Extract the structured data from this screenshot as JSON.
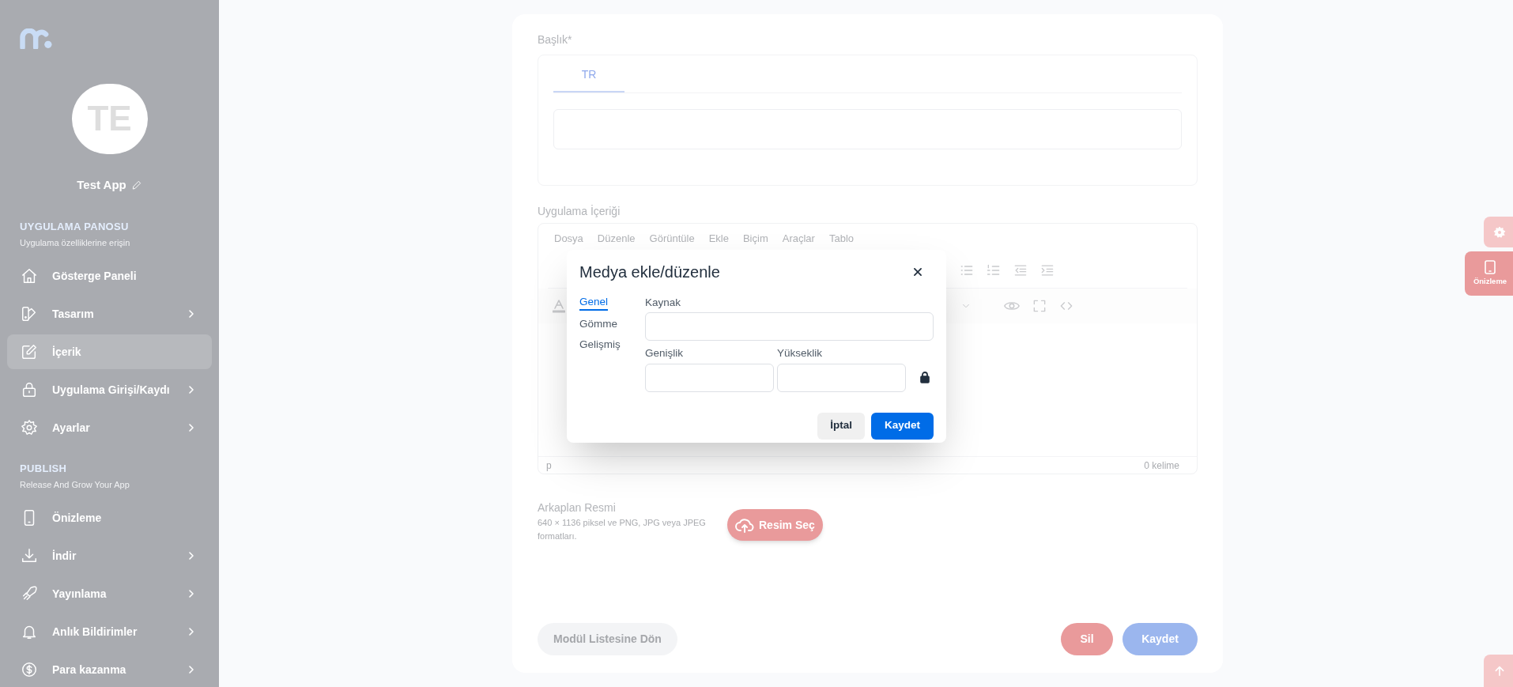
{
  "sidebar": {
    "avatar": {
      "initials": "TE"
    },
    "app_name": "Test App",
    "sections": [
      {
        "title": "UYGULAMA PANOSU",
        "subtitle": "Uygulama özelliklerine erişin",
        "items": [
          {
            "label": "Gösterge Paneli",
            "selected": false,
            "has_submenu": false
          },
          {
            "label": "Tasarım",
            "selected": false,
            "has_submenu": true
          },
          {
            "label": "İçerik",
            "selected": true,
            "has_submenu": false
          },
          {
            "label": "Uygulama Girişi/Kaydı",
            "selected": false,
            "has_submenu": true
          },
          {
            "label": "Ayarlar",
            "selected": false,
            "has_submenu": true
          }
        ]
      },
      {
        "title": "PUBLISH",
        "subtitle": "Release And Grow Your App",
        "items": [
          {
            "label": "Önizleme",
            "selected": false,
            "has_submenu": false
          },
          {
            "label": "İndir",
            "selected": false,
            "has_submenu": true
          },
          {
            "label": "Yayınlama",
            "selected": false,
            "has_submenu": true
          },
          {
            "label": "Anlık Bildirimler",
            "selected": false,
            "has_submenu": true
          },
          {
            "label": "Para kazanma",
            "selected": false,
            "has_submenu": true
          }
        ]
      }
    ]
  },
  "form": {
    "title_label": "Başlık*",
    "language_tabs": [
      {
        "label": "TR",
        "selected": true
      }
    ],
    "content_label": "Uygulama İçeriği",
    "editor": {
      "menu": [
        "Dosya",
        "Düzenle",
        "Görüntüle",
        "Ekle",
        "Biçim",
        "Araçlar",
        "Tablo"
      ],
      "status_path": "p",
      "word_count": "0 kelime"
    },
    "background": {
      "label": "Arkaplan Resmi",
      "hint": "640 × 1136 piksel ve PNG, JPG veya JPEG formatları.",
      "button": "Resim Seç"
    },
    "back_button": "Modül Listesine Dön",
    "delete_button": "Sil",
    "save_button": "Kaydet"
  },
  "floating": {
    "preview_label": "Önizleme"
  },
  "modal": {
    "title": "Medya ekle/düzenle",
    "tabs": [
      {
        "label": "Genel",
        "selected": true
      },
      {
        "label": "Gömme",
        "selected": false
      },
      {
        "label": "Gelişmiş",
        "selected": false
      }
    ],
    "source_label": "Kaynak",
    "width_label": "Genişlik",
    "height_label": "Yükseklik",
    "cancel_button": "İptal",
    "save_button": "Kaydet"
  }
}
